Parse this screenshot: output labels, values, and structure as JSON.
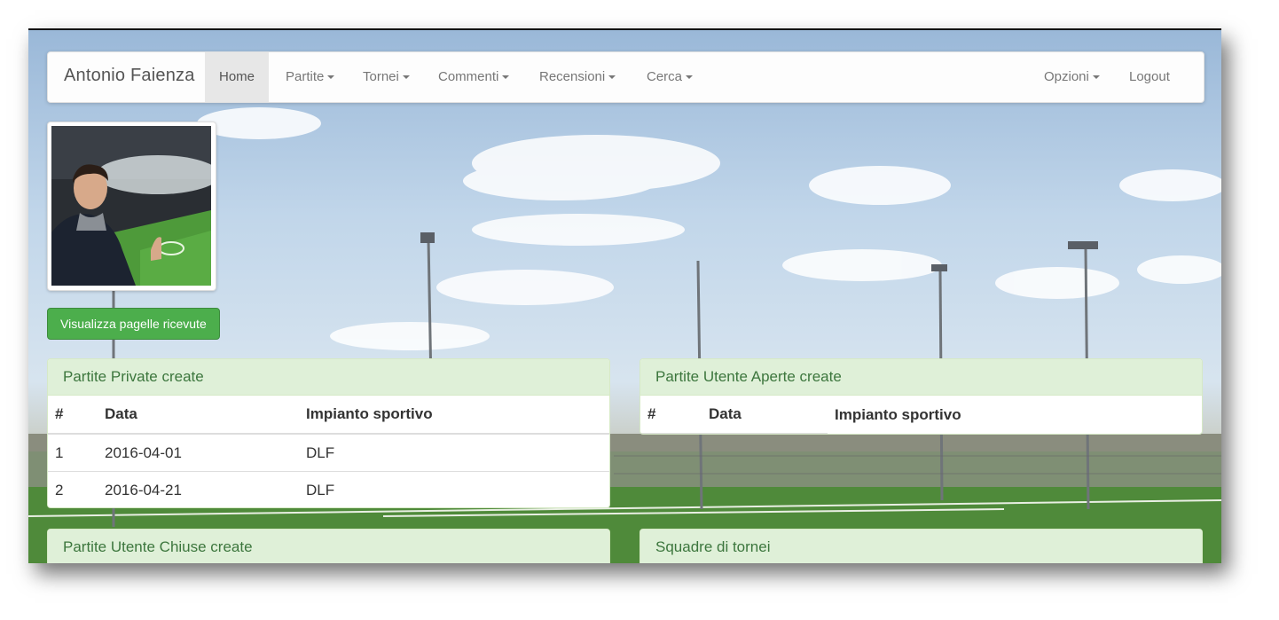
{
  "navbar": {
    "brand": "Antonio Faienza",
    "home": "Home",
    "menus": [
      "Partite",
      "Tornei",
      "Commenti",
      "Recensioni",
      "Cerca"
    ],
    "options": "Opzioni",
    "logout": "Logout"
  },
  "profile": {
    "button_label": "Visualizza pagelle ricevute"
  },
  "panels": {
    "private": {
      "title": "Partite Private create",
      "headers": [
        "#",
        "Data",
        "Impianto sportivo"
      ],
      "rows": [
        [
          "1",
          "2016-04-01",
          "DLF"
        ],
        [
          "2",
          "2016-04-21",
          "DLF"
        ]
      ]
    },
    "open": {
      "title": "Partite Utente Aperte create",
      "headers": [
        "#",
        "Data",
        "Impianto sportivo"
      ],
      "rows": []
    },
    "closed": {
      "title": "Partite Utente Chiuse create"
    },
    "teams": {
      "title": "Squadre di tornei"
    }
  },
  "colors": {
    "panel_heading_bg": "#dff0d8",
    "panel_heading_text": "#3c763d",
    "button_green": "#4cae4c"
  }
}
